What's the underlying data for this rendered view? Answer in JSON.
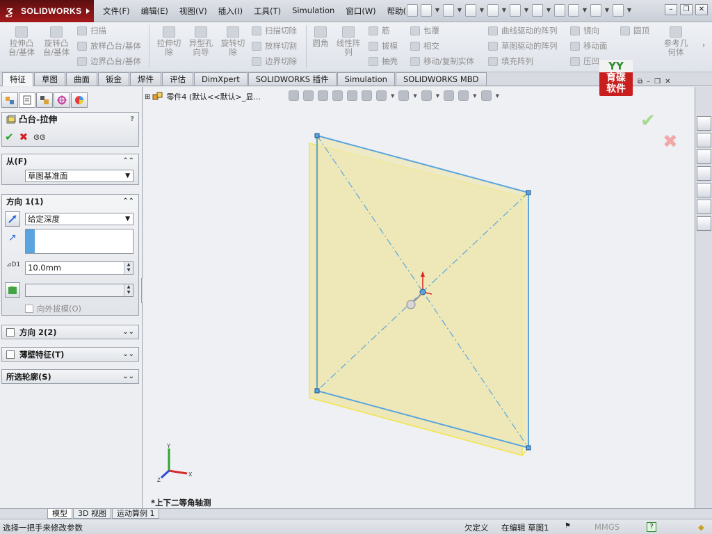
{
  "app": {
    "logo_text": "SOLIDWORKS"
  },
  "menu": [
    "文件(F)",
    "编辑(E)",
    "视图(V)",
    "插入(I)",
    "工具(T)",
    "Simulation",
    "窗口(W)",
    "帮助(H)"
  ],
  "ribbon": {
    "extrude_boss": "拉伸凸\n台/基体",
    "revolve_boss": "旋转凸\n台/基体",
    "sweep": "扫描",
    "loft": "放样凸台/基体",
    "boundary_boss": "边界凸台/基体",
    "extrude_cut": "拉伸切\n除",
    "hole_wizard": "异型孔\n向导",
    "revolve_cut": "旋转切\n除",
    "swept_cut": "扫描切除",
    "lofted_cut": "放样切割",
    "boundary_cut": "边界切除",
    "fillet": "圆角",
    "linear_pattern": "线性阵\n列",
    "rib": "筋",
    "draft": "拔模",
    "shell": "抽壳",
    "wrap": "包覆",
    "intersect": "相交",
    "mirror_copy": "移动/复制实体",
    "curve_pattern": "曲线驱动的阵列",
    "sketch_pattern": "草图驱动的阵列",
    "fill_pattern": "填充阵列",
    "mirror": "镜向",
    "move_face": "移动面",
    "indent": "压凹",
    "dome": "圆顶",
    "ref_geometry": "参考几\n何体"
  },
  "tabs": [
    "特征",
    "草图",
    "曲面",
    "钣金",
    "焊件",
    "评估",
    "DimXpert",
    "SOLIDWORKS 插件",
    "Simulation",
    "SOLIDWORKS MBD"
  ],
  "property_manager": {
    "title": "凸台-拉伸",
    "help": "?",
    "from": {
      "header": "从(F)",
      "value": "草图基准面"
    },
    "direction1": {
      "header": "方向 1(1)",
      "end_condition": "给定深度",
      "depth": "10.0mm",
      "draft_outward": "向外拔模(O)"
    },
    "direction2": {
      "header": "方向 2(2)"
    },
    "thin_feature": {
      "header": "薄壁特征(T)"
    },
    "selected_contours": {
      "header": "所选轮廓(S)"
    }
  },
  "graphics": {
    "tree_root": "零件4 (默认<<默认>_显...",
    "view_label": "*上下二等角轴测",
    "axes": {
      "x": "X",
      "y": "Y",
      "z": "Z"
    }
  },
  "bottom_tabs": [
    "模型",
    "3D 视图",
    "运动算例 1"
  ],
  "status": {
    "message": "选择一把手来修改参数",
    "state": "欠定义",
    "editing": "在编辑 草图1",
    "units": "MMGS",
    "help": "?"
  },
  "watermark": {
    "top": "YY",
    "text": "育碟\n软件"
  },
  "colors": {
    "sketch_line": "#5aa5e0",
    "preview_fill": "#eee8b8",
    "preview_edge": "#f2e44a",
    "accept": "#27a327",
    "cancel": "#d62020"
  }
}
